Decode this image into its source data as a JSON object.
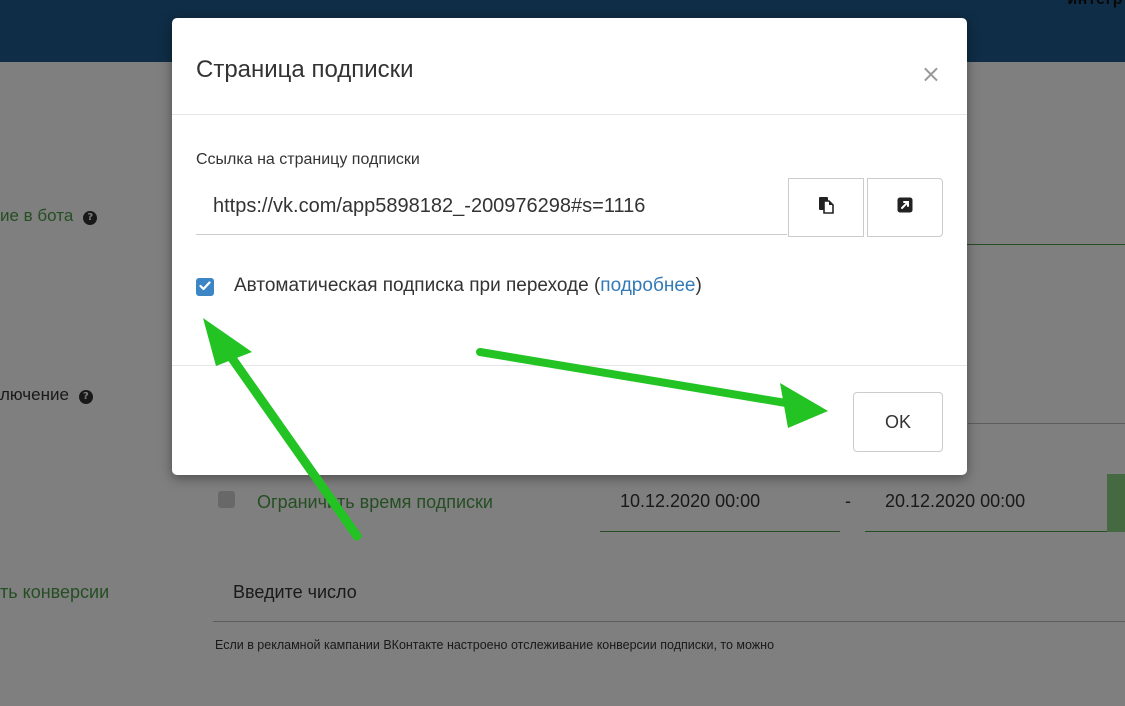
{
  "background": {
    "top_right_text": "интегр",
    "label_bot": "ие в бота",
    "label_connection": "лючение",
    "limit_label": "Ограничить время подписки",
    "date_from": "10.12.2020 00:00",
    "date_separator": "-",
    "date_to": "20.12.2020 00:00",
    "label_conversion": "ть конверсии",
    "number_placeholder": "Введите число",
    "hint": "Если в рекламной кампании ВКонтакте настроено отслеживание конверсии подписки, то можно"
  },
  "modal": {
    "title": "Страница подписки",
    "close_symbol": "×",
    "link_label": "Ссылка на страницу подписки",
    "link_value": "https://vk.com/app5898182_-200976298#s=1116",
    "auto_subscribe": {
      "checked": true,
      "text_before": "Автоматическая подписка при переходе (",
      "link_text": "подробнее",
      "text_after": ")"
    },
    "ok_label": "OK"
  },
  "colors": {
    "header_blue": "#1f5a8c",
    "accent_green": "#4a9d46",
    "arrow_green": "#22c322",
    "checkbox_blue": "#3d86c6",
    "link_blue": "#337ab7"
  },
  "icons": {
    "copy": "copy-icon",
    "open": "external-link-icon",
    "help": "question-circle-icon"
  }
}
